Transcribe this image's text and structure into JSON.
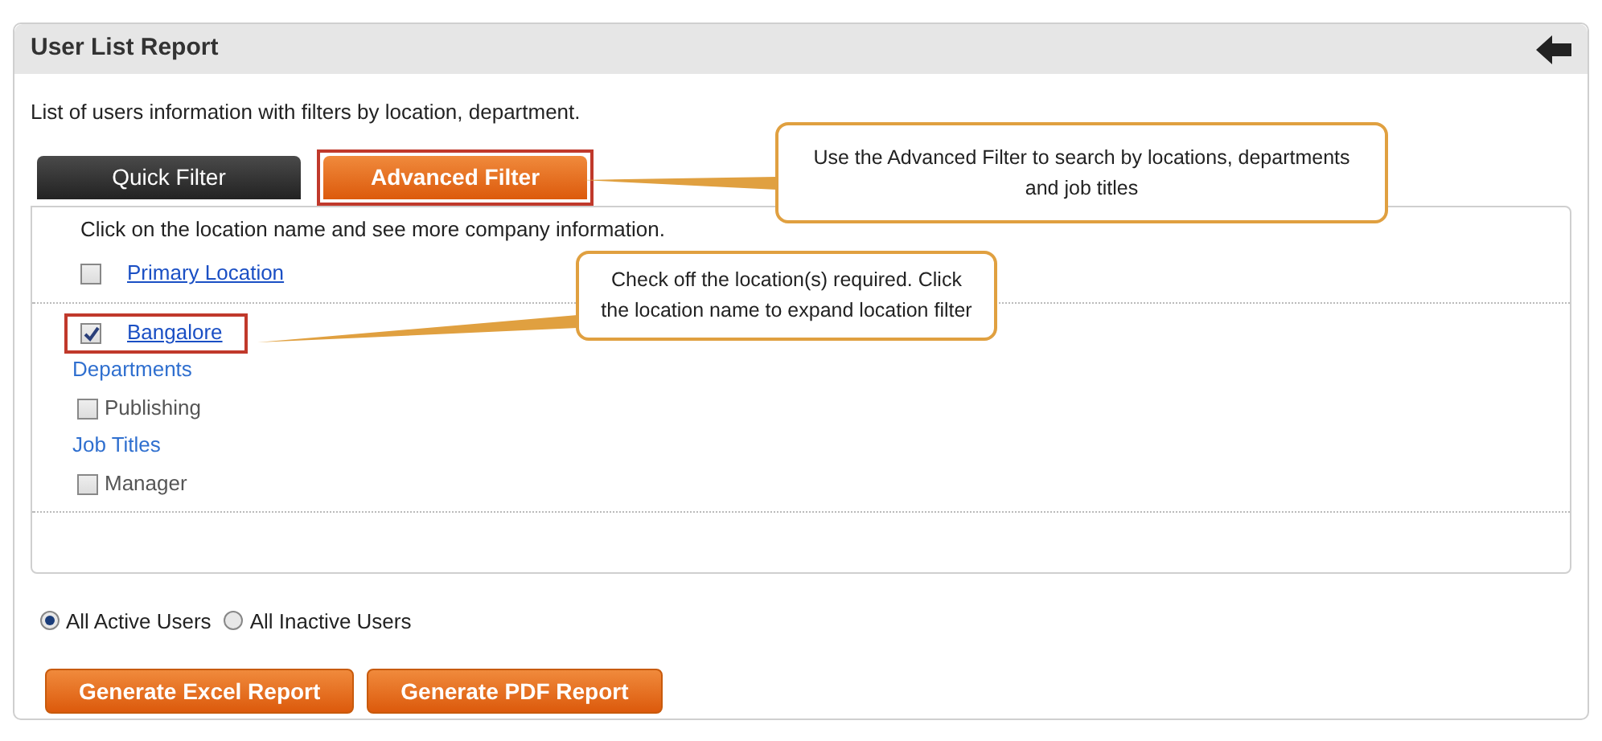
{
  "panel": {
    "title": "User List Report",
    "description": "List of users information with filters by location, department."
  },
  "tabs": [
    {
      "label": "Quick Filter",
      "selected": false,
      "highlighted": false
    },
    {
      "label": "Advanced Filter",
      "selected": true,
      "highlighted": true
    }
  ],
  "filter": {
    "intro": "Click on the location name and see more company information.",
    "locations": [
      {
        "label": "Primary Location",
        "checked": false,
        "highlighted": false
      },
      {
        "label": "Bangalore",
        "checked": true,
        "highlighted": true
      }
    ],
    "sections": [
      {
        "title": "Departments",
        "options": [
          {
            "label": "Publishing",
            "checked": false
          }
        ]
      },
      {
        "title": "Job Titles",
        "options": [
          {
            "label": "Manager",
            "checked": false
          }
        ]
      }
    ]
  },
  "user_status": [
    {
      "label": "All Active Users",
      "selected": true
    },
    {
      "label": "All Inactive Users",
      "selected": false
    }
  ],
  "buttons": [
    "Generate Excel Report",
    "Generate PDF Report"
  ],
  "callouts": [
    {
      "text": "Use the Advanced Filter to search by locations, departments and job titles"
    },
    {
      "text": "Check off the location(s) required.  Click the location name to expand location filter"
    }
  ]
}
